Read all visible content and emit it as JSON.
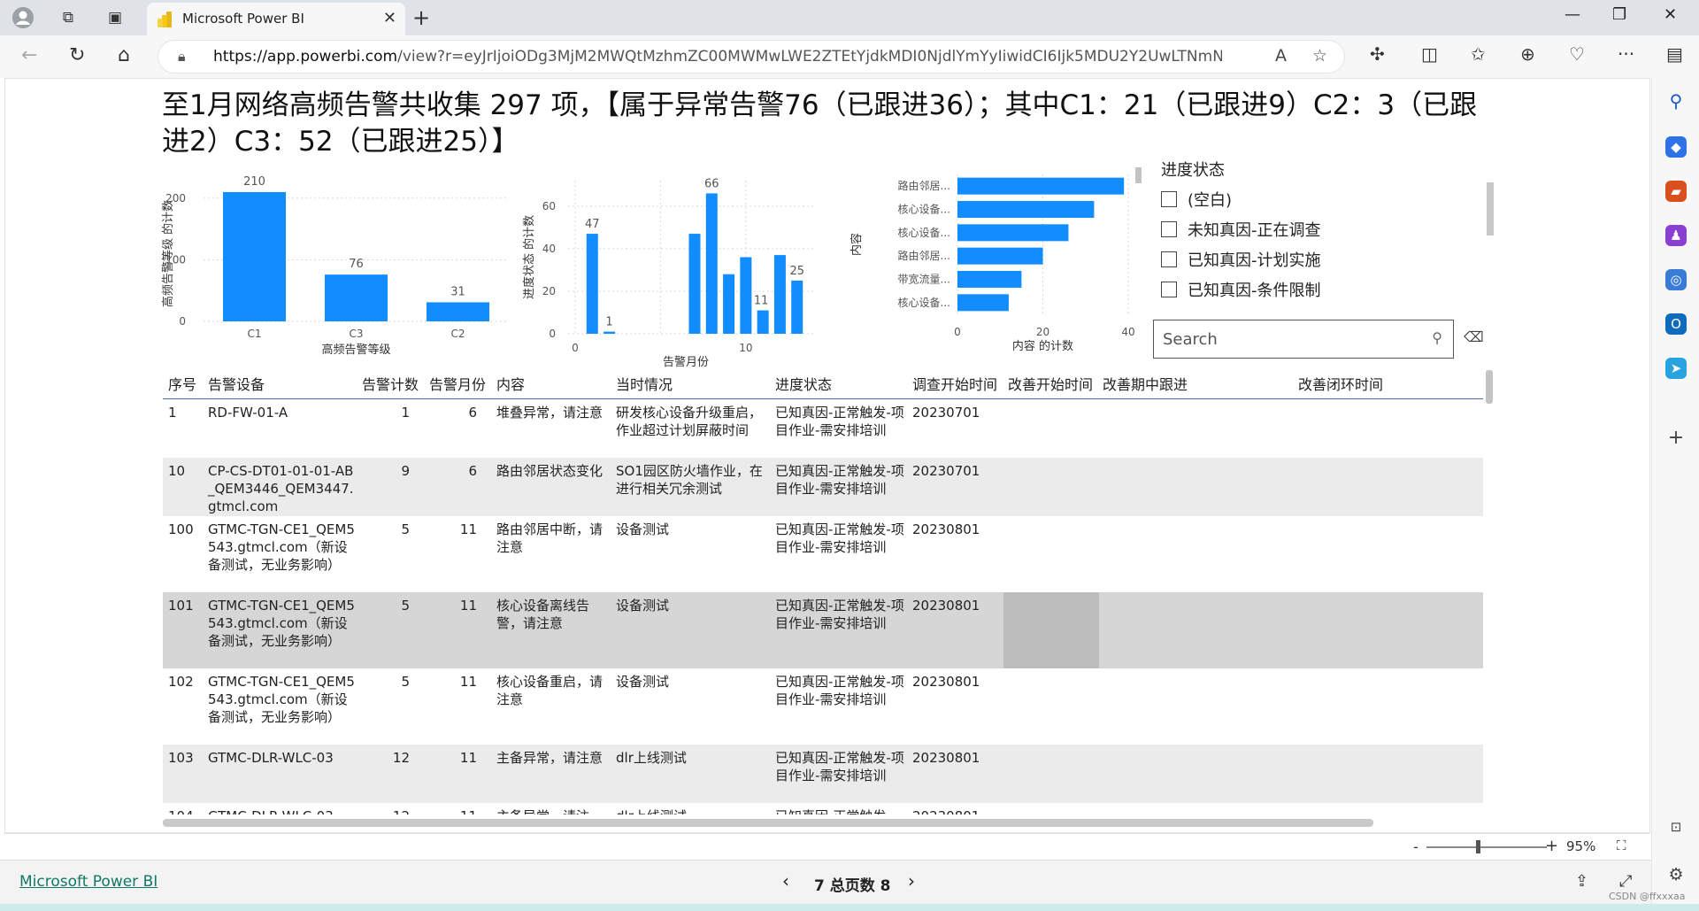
{
  "browser": {
    "tab_title": "Microsoft Power BI",
    "url_domain": "https://app.powerbi.com",
    "url_rest": "/view?r=eyJrIjoiODg3MjM2MWQtMzhmZC00MWMwLWE2ZTEtYjdkMDI0NjdlYmYyIiwidCI6Ijk5MDU2Y2UwLTNmNmQtNGNmZ..."
  },
  "report": {
    "headline": "至1月网络高频告警共收集 297 项，【属于异常告警76（已跟进36）；其中C1：21（已跟进9）C2：3（已跟进2）C3：52（已跟进25）】"
  },
  "chart_data": [
    {
      "type": "bar",
      "categories": [
        "C1",
        "C3",
        "C2"
      ],
      "values": [
        210,
        76,
        31
      ],
      "xlabel": "高频告警等级",
      "ylabel": "高频告警等级 的计数",
      "yticks": [
        0,
        100,
        200
      ],
      "ylim": [
        0,
        220
      ],
      "color": "#118dff"
    },
    {
      "type": "bar",
      "x": [
        1,
        2,
        7,
        8,
        9,
        10,
        11,
        12,
        13
      ],
      "values": [
        47,
        1,
        47,
        66,
        28,
        36,
        11,
        37,
        25
      ],
      "value_labels": [
        "47",
        "1",
        "",
        "66",
        "",
        "",
        "11",
        "",
        "25"
      ],
      "xlabel": "告警月份",
      "ylabel": "进度状态 的计数",
      "xticks": [
        0,
        10
      ],
      "xlim": [
        0,
        14
      ],
      "yticks": [
        0,
        20,
        40,
        60
      ],
      "ylim": [
        0,
        72
      ],
      "color": "#118dff"
    },
    {
      "type": "bar",
      "orientation": "horizontal",
      "categories": [
        "路由邻居...",
        "核心设备...",
        "核心设备...",
        "路由邻居...",
        "带宽流量...",
        "核心设备..."
      ],
      "values": [
        39,
        32,
        26,
        20,
        15,
        12
      ],
      "xlabel": "内容 的计数",
      "ylabel": "内容",
      "xticks": [
        0,
        20,
        40
      ],
      "xlim": [
        0,
        40
      ],
      "color": "#118dff"
    }
  ],
  "slicer": {
    "title": "进度状态",
    "options": [
      "(空白)",
      "未知真因-正在调查",
      "已知真因-计划实施",
      "已知真因-条件限制"
    ],
    "search_placeholder": "Search"
  },
  "table": {
    "headers": [
      "序号",
      "告警设备",
      "告警计数",
      "告警月份",
      "内容",
      "当时情况",
      "进度状态",
      "调查开始时间",
      "改善开始时间",
      "改善期中跟进",
      "改善闭环时间"
    ],
    "rows": [
      [
        "1",
        "RD-FW-01-A",
        "1",
        "6",
        "堆叠异常，请注意",
        "研发核心设备升级重启，作业超过计划屏蔽时间",
        "已知真因-正常触发-项目作业-需安排培训",
        "20230701",
        "",
        "",
        ""
      ],
      [
        "10",
        "CP-CS-DT01-01-01-AB_QEM3446_QEM3447.gtmcl.com",
        "9",
        "6",
        "路由邻居状态变化",
        "SO1园区防火墙作业，在进行相关冗余测试",
        "已知真因-正常触发-项目作业-需安排培训",
        "20230701",
        "",
        "",
        ""
      ],
      [
        "100",
        "GTMC-TGN-CE1_QEM5543.gtmcl.com（新设备测试，无业务影响）",
        "5",
        "11",
        "路由邻居中断，请注意",
        "设备测试",
        "已知真因-正常触发-项目作业-需安排培训",
        "20230801",
        "",
        "",
        ""
      ],
      [
        "101",
        "GTMC-TGN-CE1_QEM5543.gtmcl.com（新设备测试，无业务影响）",
        "5",
        "11",
        "核心设备离线告警，请注意",
        "设备测试",
        "已知真因-正常触发-项目作业-需安排培训",
        "20230801",
        "",
        "",
        ""
      ],
      [
        "102",
        "GTMC-TGN-CE1_QEM5543.gtmcl.com（新设备测试，无业务影响）",
        "5",
        "11",
        "核心设备重启，请注意",
        "设备测试",
        "已知真因-正常触发-项目作业-需安排培训",
        "20230801",
        "",
        "",
        ""
      ],
      [
        "103",
        "GTMC-DLR-WLC-03",
        "12",
        "11",
        "主备异常，请注意",
        "dlr上线测试",
        "已知真因-正常触发-项目作业-需安排培训",
        "20230801",
        "",
        "",
        ""
      ],
      [
        "104",
        "GTMC-DLR-WLC-03",
        "12",
        "11",
        "主备异常，请注",
        "dlr上线测试",
        "已知真因-正常触发-",
        "20230801",
        "",
        "",
        ""
      ]
    ]
  },
  "zoom": {
    "minus": "-",
    "plus": "+",
    "percent": "95%"
  },
  "footer": {
    "brand": "Microsoft Power BI",
    "pages": "7 总页数 8",
    "prev": "‹",
    "next": "›"
  },
  "watermark": "CSDN @ffxxxaa"
}
